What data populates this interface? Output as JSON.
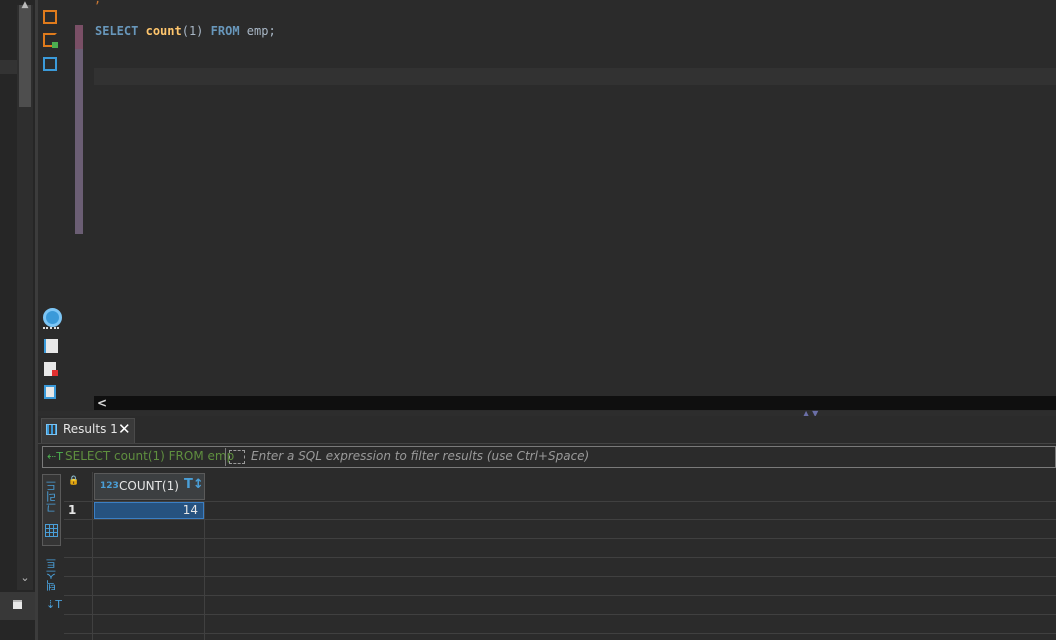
{
  "editor": {
    "prev_line_char": ";",
    "sql": {
      "select": "SELECT",
      "func": "count",
      "args": "(1)",
      "from": "FROM",
      "table": "emp;"
    },
    "scroll_left": "<"
  },
  "results": {
    "tab_label": "Results 1",
    "tab_close": "✕",
    "filter": {
      "query": "SELECT count(1) FROM emp",
      "placeholder": "Enter a SQL expression to filter results (use Ctrl+Space)"
    },
    "view_tabs": {
      "grid_label": "그리드",
      "text_label": "텍스트"
    },
    "columns": [
      {
        "type_badge": "123",
        "name": "COUNT(1)"
      }
    ],
    "rows": [
      {
        "row_number": "1",
        "value": "14"
      }
    ]
  },
  "colors": {
    "background": "#2b2b2b",
    "keyword": "#6897bb",
    "function": "#ffc66d",
    "selected_cell": "#26527f",
    "accent": "#4a9fd8"
  }
}
